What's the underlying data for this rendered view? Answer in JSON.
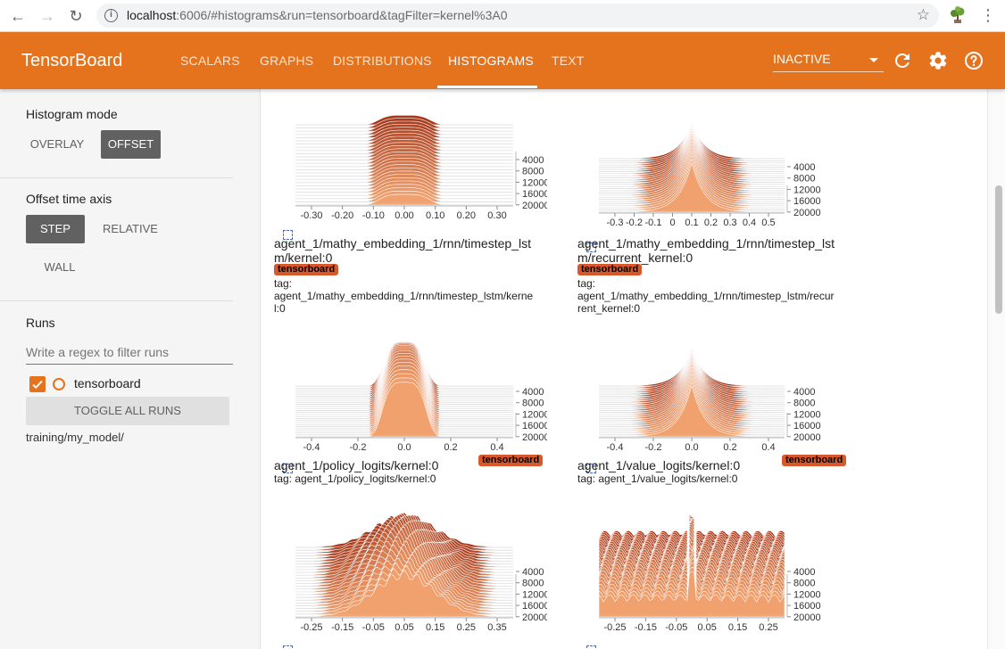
{
  "browser": {
    "url_host": "localhost",
    "url_rest": ":6006/#histograms&run=tensorboard&tagFilter=kernel%3A0"
  },
  "header": {
    "title": "TensorBoard",
    "tabs": [
      {
        "label": "SCALARS"
      },
      {
        "label": "GRAPHS"
      },
      {
        "label": "DISTRIBUTIONS"
      },
      {
        "label": "HISTOGRAMS"
      },
      {
        "label": "TEXT"
      }
    ],
    "active_tab": "HISTOGRAMS",
    "status_select": "INACTIVE"
  },
  "sidebar": {
    "histogram_mode": {
      "title": "Histogram mode",
      "options": [
        "OVERLAY",
        "OFFSET"
      ],
      "selected": "OFFSET"
    },
    "offset_time_axis": {
      "title": "Offset time axis",
      "options": [
        "STEP",
        "RELATIVE",
        "WALL"
      ],
      "selected": "STEP"
    },
    "runs": {
      "title": "Runs",
      "filter_placeholder": "Write a regex to filter runs",
      "items": [
        {
          "name": "tensorboard",
          "checked": true
        }
      ],
      "toggle_label": "TOGGLE ALL RUNS",
      "directory": "training/my_model/"
    }
  },
  "cards": [
    {
      "title_l1": "agent_1/mathy_embedding_1/rnn/timestep_lst",
      "title_l2": "m/kernel:0",
      "badge": "tensorboard",
      "tag_l1": "tag:",
      "tag_l2": "agent_1/mathy_embedding_1/rnn/timestep_lstm/kerne",
      "tag_l3": "l:0",
      "x_ticks": [
        "-0.30",
        "-0.20",
        "-0.10",
        "0.00",
        "0.10",
        "0.20",
        "0.30"
      ],
      "y_ticks": [
        "4000",
        "8000",
        "12000",
        "16000",
        "20000"
      ]
    },
    {
      "title_l1": "agent_1/mathy_embedding_1/rnn/timestep_lst",
      "title_l2": "m/recurrent_kernel:0",
      "badge": "tensorboard",
      "tag_l1": "tag:",
      "tag_l2": "agent_1/mathy_embedding_1/rnn/timestep_lstm/recur",
      "tag_l3": "rent_kernel:0",
      "x_ticks": [
        "-0.3",
        "-0.2",
        "-0.1",
        "0",
        "0.1",
        "0.2",
        "0.3",
        "0.4",
        "0.5"
      ],
      "y_ticks": [
        "4000",
        "8000",
        "12000",
        "16000",
        "20000"
      ]
    },
    {
      "title_l1": "agent_1/policy_logits/kernel:0",
      "badge": "tensorboard",
      "tag_l1": "tag: agent_1/policy_logits/kernel:0",
      "x_ticks": [
        "-0.4",
        "-0.2",
        "0.0",
        "0.2",
        "0.4"
      ],
      "y_ticks": [
        "4000",
        "8000",
        "12000",
        "16000",
        "20000"
      ]
    },
    {
      "title_l1": "agent_1/value_logits/kernel:0",
      "badge": "tensorboard",
      "tag_l1": "tag: agent_1/value_logits/kernel:0",
      "x_ticks": [
        "-0.4",
        "-0.2",
        "0.0",
        "0.2",
        "0.4"
      ],
      "y_ticks": [
        "4000",
        "8000",
        "12000",
        "16000",
        "20000"
      ]
    },
    {
      "x_ticks": [
        "-0.25",
        "-0.15",
        "-0.05",
        "0.05",
        "0.15",
        "0.25",
        "0.35"
      ],
      "y_ticks": [
        "4000",
        "8000",
        "12000",
        "16000",
        "20000"
      ]
    },
    {
      "x_ticks": [
        "-0.25",
        "-0.15",
        "-0.05",
        "0.05",
        "0.15",
        "0.25"
      ],
      "y_ticks": [
        "4000",
        "8000",
        "12000",
        "16000",
        "20000"
      ]
    }
  ],
  "colors": {
    "brand": "#e5731d",
    "badge": "#d7582b",
    "hist_dark": "#a63a1c",
    "hist_light": "#f2a26f"
  },
  "icons": {
    "refresh": "refresh-icon",
    "settings": "gear-icon",
    "help": "help-icon"
  }
}
